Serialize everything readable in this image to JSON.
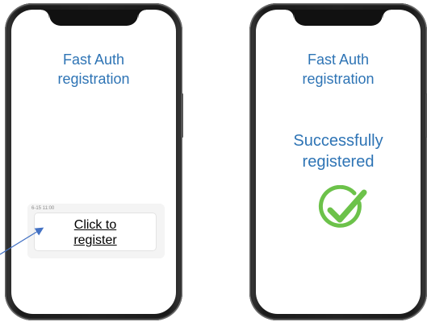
{
  "screens": {
    "left": {
      "title_lines": [
        "Fast Auth",
        "registration"
      ],
      "notification": {
        "time": "6-15 11:00",
        "button_lines": [
          "Click to",
          "register"
        ]
      }
    },
    "right": {
      "title_lines": [
        "Fast Auth",
        "registration"
      ],
      "status_lines": [
        "Successfully",
        "registered"
      ],
      "status_icon": "checkmark-circle-icon"
    }
  },
  "colors": {
    "title": "#2e74b5",
    "success_green": "#6cc24a",
    "arrow": "#4472c4"
  }
}
